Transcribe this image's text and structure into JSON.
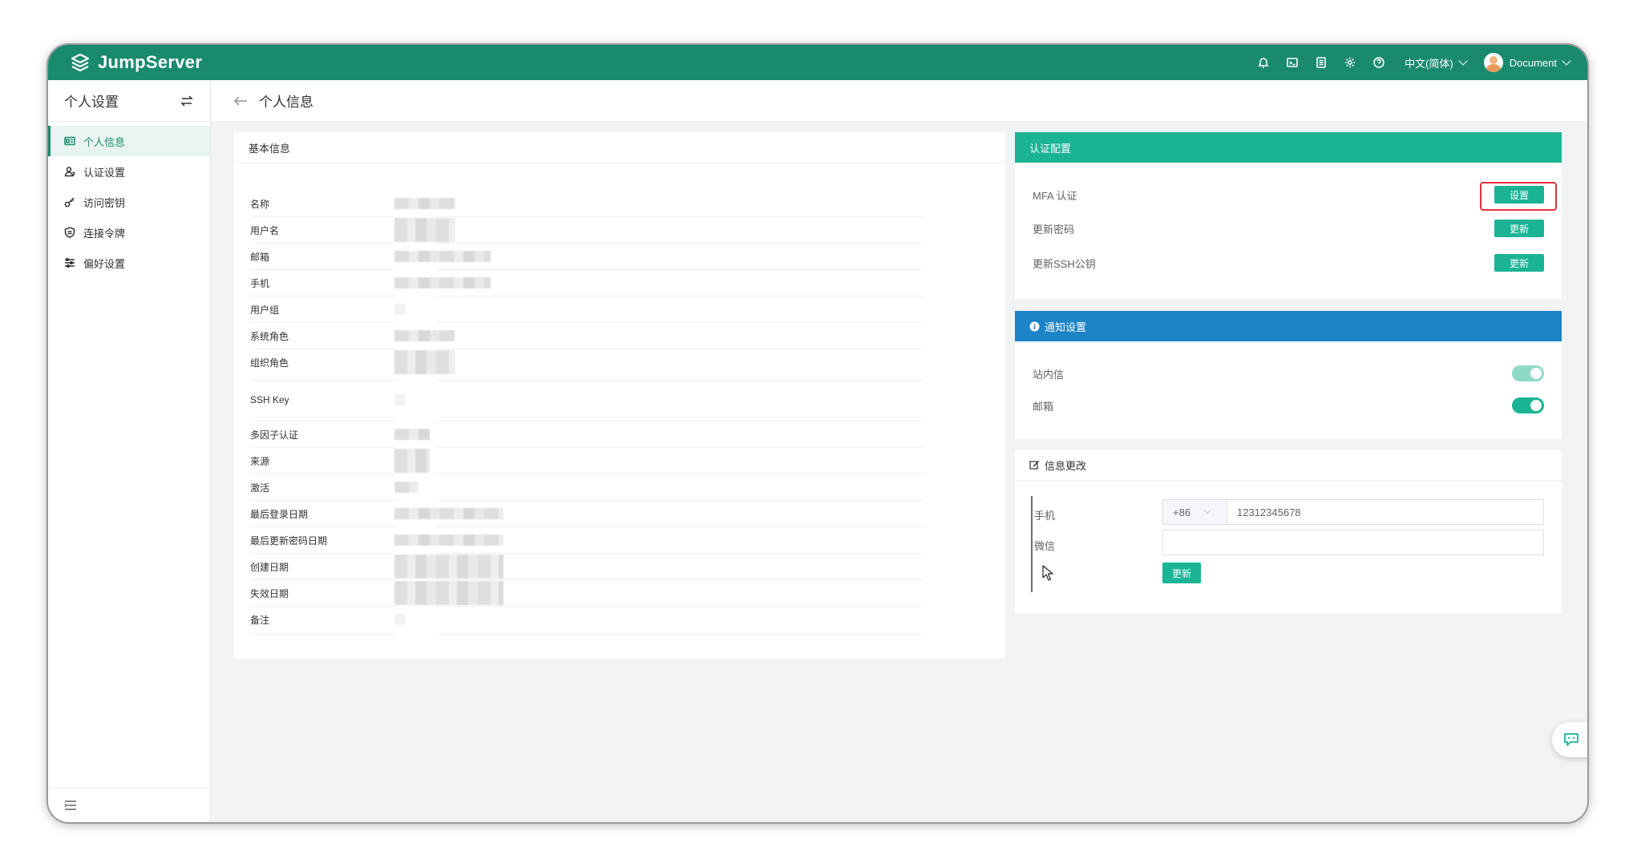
{
  "brand": {
    "name": "JumpServer"
  },
  "topbar": {
    "icons": [
      "bell-icon",
      "terminal-icon",
      "document-icon",
      "gear-icon",
      "help-icon"
    ],
    "language": "中文(简体)",
    "user": "Document"
  },
  "sidebar": {
    "title": "个人设置",
    "items": [
      {
        "label": "个人信息",
        "icon": "id-card-icon",
        "active": true
      },
      {
        "label": "认证设置",
        "icon": "user-shield-icon",
        "active": false
      },
      {
        "label": "访问密钥",
        "icon": "key-icon",
        "active": false
      },
      {
        "label": "连接令牌",
        "icon": "token-icon",
        "active": false
      },
      {
        "label": "偏好设置",
        "icon": "sliders-icon",
        "active": false
      }
    ]
  },
  "breadcrumb": {
    "title": "个人信息"
  },
  "basic_info": {
    "title": "基本信息",
    "fields": [
      "名称",
      "用户名",
      "邮箱",
      "手机",
      "用户组",
      "系统角色",
      "组织角色",
      "SSH Key",
      "多因子认证",
      "来源",
      "激活",
      "最后登录日期",
      "最后更新密码日期",
      "创建日期",
      "失效日期",
      "备注"
    ]
  },
  "auth_config": {
    "title": "认证配置",
    "rows": [
      {
        "label": "MFA 认证",
        "button": "设置"
      },
      {
        "label": "更新密码",
        "button": "更新"
      },
      {
        "label": "更新SSH公钥",
        "button": "更新"
      }
    ]
  },
  "notify": {
    "title": "通知设置",
    "rows": [
      {
        "label": "站内信",
        "enabled": true
      },
      {
        "label": "邮箱",
        "enabled": true
      }
    ]
  },
  "info_change": {
    "title": "信息更改",
    "phone_label": "手机",
    "phone_prefix": "+86",
    "phone_value": "12312345678",
    "wechat_label": "微信",
    "wechat_value": "",
    "submit": "更新"
  },
  "colors": {
    "topbar": "#1a8a6e",
    "teal": "#1ab394",
    "blue": "#1c84c6",
    "highlight": "#e0323c"
  }
}
